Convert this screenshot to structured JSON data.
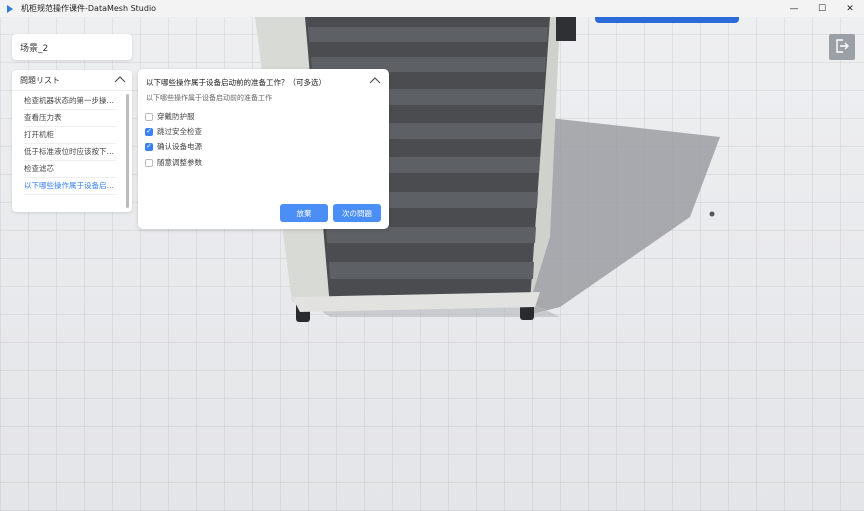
{
  "window": {
    "title": "机柜规范操作课件-DataMesh Studio",
    "minimize": "—",
    "maximize": "☐",
    "close": "✕"
  },
  "scene": {
    "name": "场景_2"
  },
  "question_list": {
    "header": "問題リスト",
    "items": [
      "检查机器状态的第一步操作是什么？",
      "查看压力表",
      "打开机柜",
      "低于标准液位时应该按下哪个按钮？",
      "检查滤芯",
      "以下哪些操作属于设备启动前的准备工作？"
    ],
    "active_index": 5
  },
  "question_panel": {
    "title": "以下哪些操作属于设备启动前的准备工作？（可多选）",
    "subtitle": "以下哪些操作属于设备启动前的准备工作",
    "options": [
      {
        "label": "穿戴防护服",
        "checked": false
      },
      {
        "label": "跳过安全检查",
        "checked": true
      },
      {
        "label": "确认设备电源",
        "checked": true
      },
      {
        "label": "随意调整参数",
        "checked": false
      }
    ],
    "give_up_button": "放棄",
    "next_button": "次の問題"
  },
  "colors": {
    "accent": "#4b8ef5",
    "active_text": "#3b82f6"
  },
  "icons": {
    "exit": "exit-icon",
    "collapse": "chevron-up-icon"
  }
}
